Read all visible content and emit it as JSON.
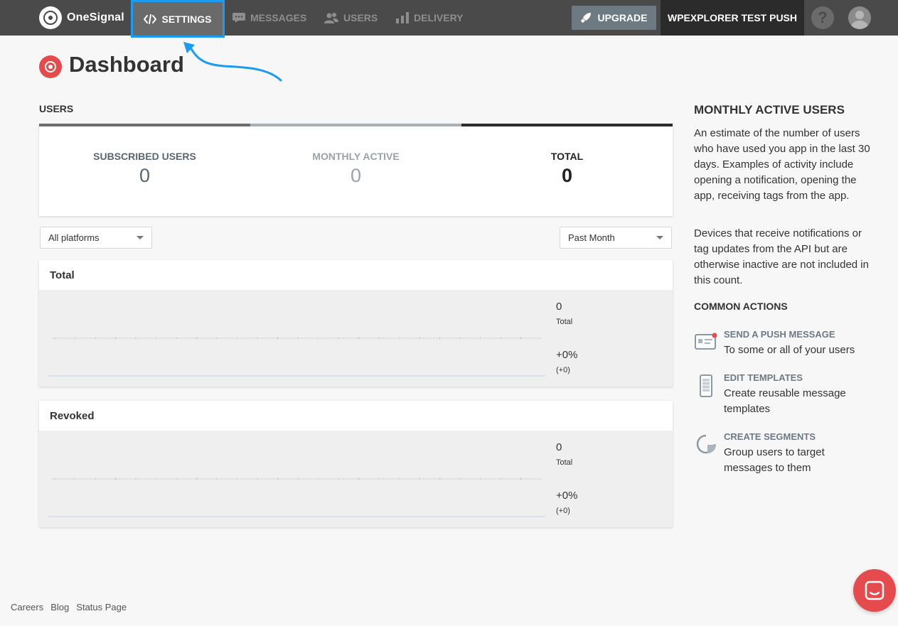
{
  "brand": {
    "name": "OneSignal"
  },
  "nav": {
    "settings": "SETTINGS",
    "messages": "MESSAGES",
    "users": "USERS",
    "delivery": "DELIVERY",
    "upgrade": "UPGRADE",
    "app_name": "WPEXPLORER TEST PUSH",
    "help": "?"
  },
  "page": {
    "title": "Dashboard"
  },
  "users_section": {
    "label": "USERS",
    "stats": [
      {
        "label": "SUBSCRIBED USERS",
        "value": "0",
        "color": "#5b6770"
      },
      {
        "label": "MONTHLY ACTIVE",
        "value": "0",
        "color": "#9aa3aa"
      },
      {
        "label": "TOTAL",
        "value": "0",
        "color": "#222222"
      }
    ],
    "tab_colors": [
      "#6b6f6c",
      "#a9b1b6",
      "#2b2b2b"
    ]
  },
  "filters": {
    "platform": "All platforms",
    "period": "Past Month"
  },
  "charts": [
    {
      "title": "Total",
      "value": "0",
      "value_label": "Total",
      "change": "+0%",
      "change_abs": "(+0)"
    },
    {
      "title": "Revoked",
      "value": "0",
      "value_label": "Total",
      "change": "+0%",
      "change_abs": "(+0)"
    }
  ],
  "sidebar": {
    "title": "MONTHLY ACTIVE USERS",
    "paragraph1": "An estimate of the number of users who have used you app in the last 30 days. Examples of activity include opening a notification, opening the app, receiving tags from the app.",
    "paragraph2": "Devices that receive notifications or tag updates from the API but are otherwise inactive are not included in this count.",
    "common_actions": "COMMON ACTIONS",
    "actions": [
      {
        "title": "SEND A PUSH MESSAGE",
        "desc": "To some or all of your users",
        "icon": "push-message-icon"
      },
      {
        "title": "EDIT TEMPLATES",
        "desc": "Create reusable message templates",
        "icon": "template-icon"
      },
      {
        "title": "CREATE SEGMENTS",
        "desc": "Group users to target messages to them",
        "icon": "segment-icon"
      }
    ]
  },
  "footer": {
    "links": [
      "Careers",
      "Blog",
      "Status Page"
    ]
  },
  "colors": {
    "accent_red": "#e54b4d",
    "highlight_blue": "#1a9cf0",
    "topbar": "#4a4a4a"
  }
}
